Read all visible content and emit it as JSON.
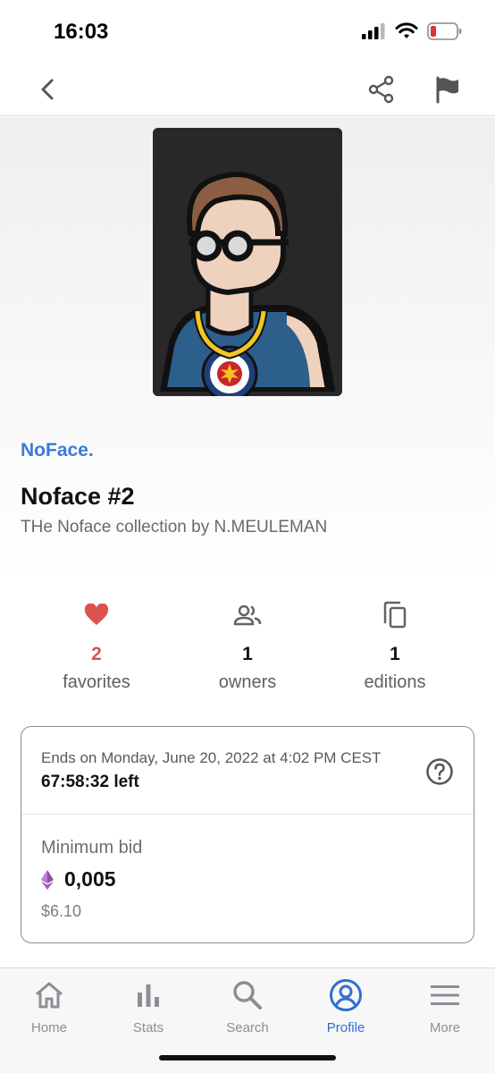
{
  "status_bar": {
    "time": "16:03",
    "icons": [
      "signal-icon",
      "wifi-icon",
      "battery-low-icon"
    ]
  },
  "nav": {
    "icons": [
      "back-chevron-icon",
      "share-icon",
      "flag-icon"
    ]
  },
  "nft": {
    "collection": "NoFace.",
    "title": "Noface #2",
    "subtitle": "THe Noface collection by N.MEULEMAN"
  },
  "stats": {
    "favorites": {
      "value": "2",
      "label": "favorites",
      "icon": "heart-icon",
      "color": "#d9534f"
    },
    "owners": {
      "value": "1",
      "label": "owners",
      "icon": "people-icon"
    },
    "editions": {
      "value": "1",
      "label": "editions",
      "icon": "copy-icon"
    }
  },
  "auction": {
    "ends_text": "Ends on Monday, June 20, 2022 at 4:02 PM CEST",
    "time_left": "67:58:32 left",
    "min_bid_label": "Minimum bid",
    "bid_value": "0,005",
    "usd_value": "$6.10",
    "currency_icon": "ethereum-icon"
  },
  "tabs": [
    {
      "label": "Home",
      "icon": "home-icon",
      "active": false
    },
    {
      "label": "Stats",
      "icon": "bar-chart-icon",
      "active": false
    },
    {
      "label": "Search",
      "icon": "search-icon",
      "active": false
    },
    {
      "label": "Profile",
      "icon": "profile-icon",
      "active": true
    },
    {
      "label": "More",
      "icon": "menu-icon",
      "active": false
    }
  ],
  "colors": {
    "accent": "#2f6fd6",
    "collection": "#3d7bd9",
    "favorite": "#d9534f"
  }
}
